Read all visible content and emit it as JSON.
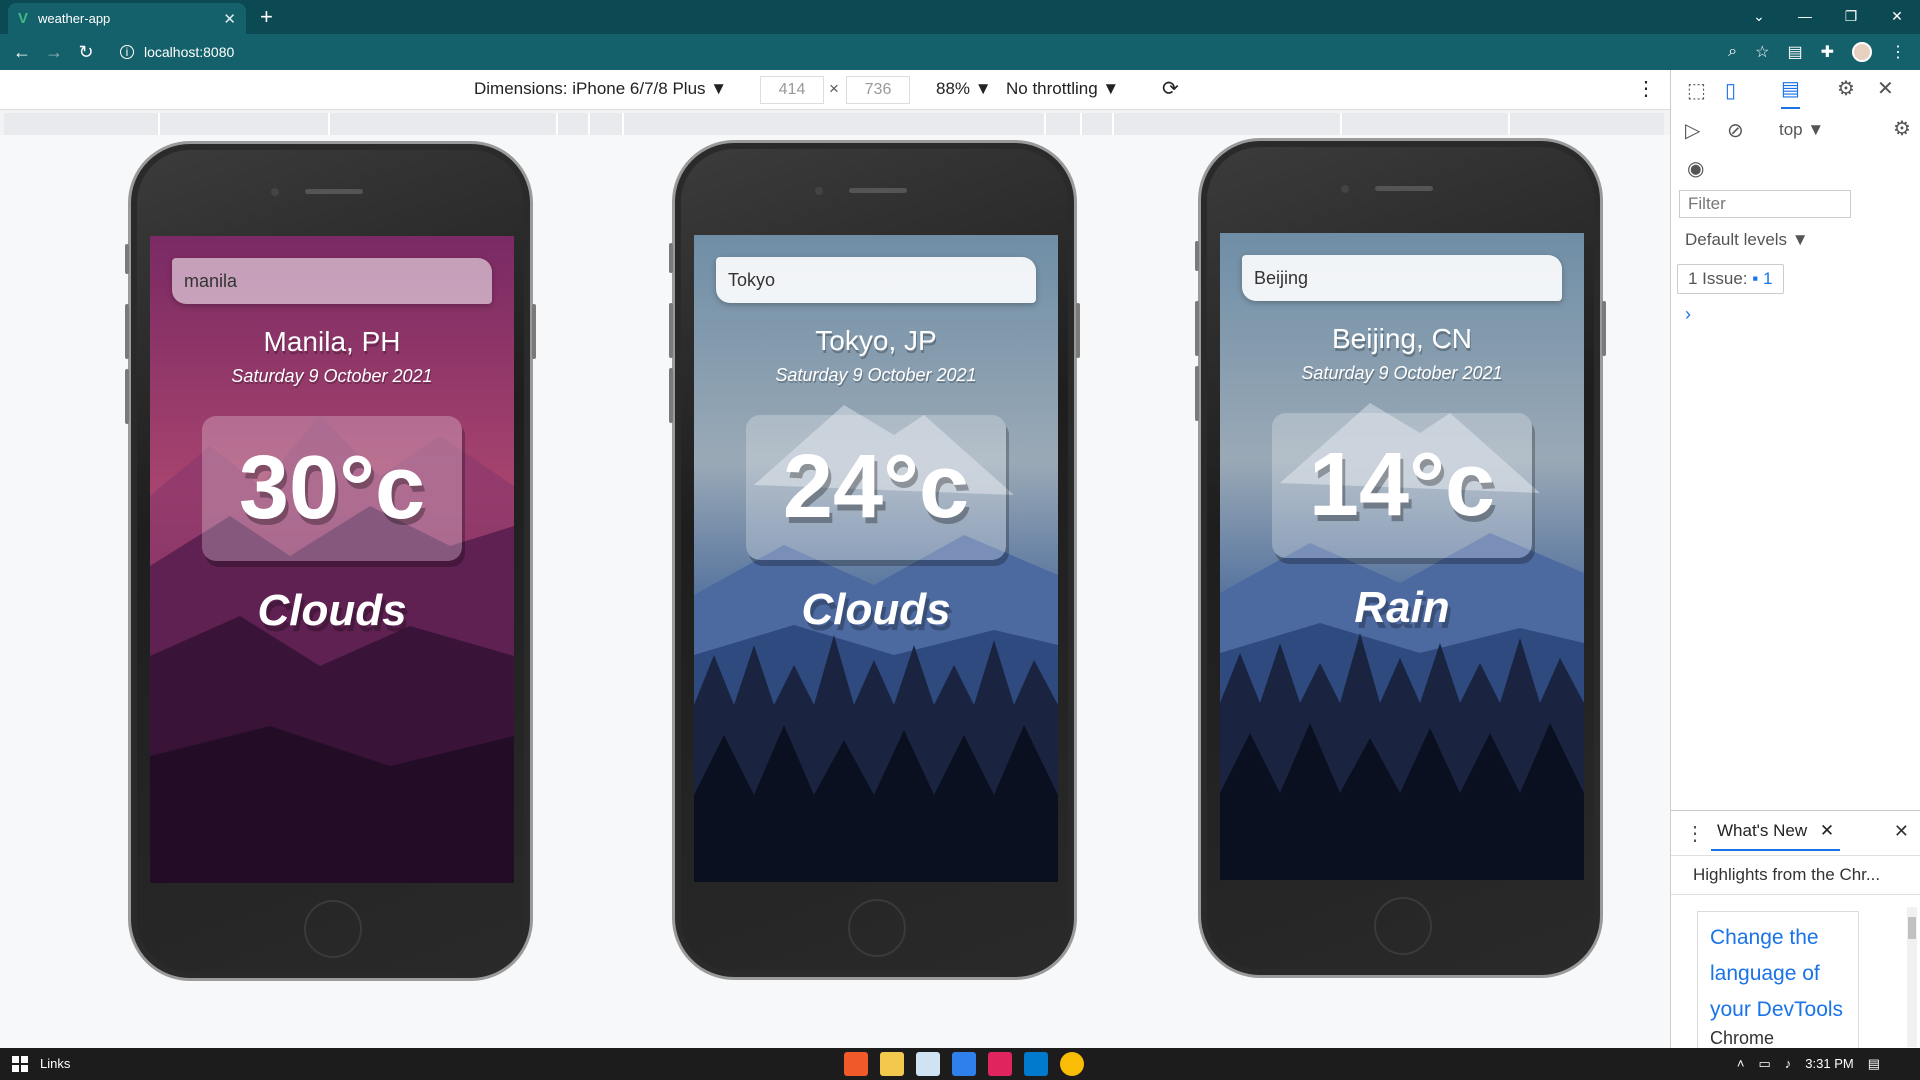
{
  "browser": {
    "tab_title": "weather-app",
    "tab_favicon": "vue-icon",
    "url": "localhost:8080"
  },
  "device_toolbar": {
    "dimensions_label": "Dimensions: iPhone 6/7/8 Plus ▼",
    "width_value": "414",
    "times": "×",
    "height_value": "736",
    "zoom": "88% ▼",
    "throttling": "No throttling ▼"
  },
  "phones": [
    {
      "search_value": "manila",
      "location": "Manila, PH",
      "date": "Saturday 9 October 2021",
      "temp": "30°c",
      "condition": "Clouds",
      "theme": "warm",
      "sky_top": "#7a2a64",
      "sky_mid": "#9c3a6c",
      "sky_bottom": "#1a0b22"
    },
    {
      "search_value": "Tokyo",
      "location": "Tokyo, JP",
      "date": "Saturday 9 October 2021",
      "temp": "24°c",
      "condition": "Clouds",
      "theme": "cool",
      "sky_top": "#6f8ea6",
      "sky_mid": "#8ea0b0",
      "sky_bottom": "#0a0f1c"
    },
    {
      "search_value": "Beijing",
      "location": "Beijing, CN",
      "date": "Saturday 9 October 2021",
      "temp": "14°c",
      "condition": "Rain",
      "theme": "cool",
      "sky_top": "#6f8ea6",
      "sky_mid": "#8ea0b0",
      "sky_bottom": "#0a0f1c"
    }
  ],
  "devtools": {
    "context": "top ▼",
    "filter_placeholder": "Filter",
    "levels": "Default levels ▼",
    "issue_label": "1 Issue:",
    "issue_count": "1",
    "prompt": "›",
    "drawer_tab": "What's New",
    "highlights": "Highlights from the Chr...",
    "card_link_lines": [
      "Change the",
      "language of",
      "your DevTools"
    ],
    "card_sub": "Chrome"
  },
  "taskbar": {
    "links": "Links",
    "time": "3:31 PM"
  }
}
